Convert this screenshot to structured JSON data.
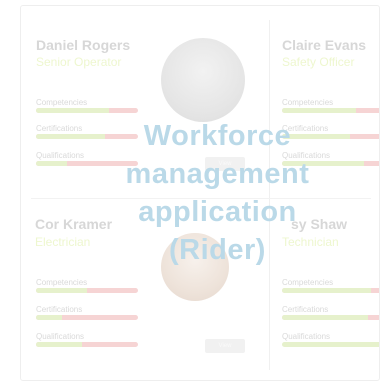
{
  "metric_labels": {
    "competencies": "Competencies",
    "certifications": "Certifications",
    "qualifications": "Qualifications"
  },
  "view_button": "View",
  "overlay": {
    "line1": "Workforce",
    "line2": "management",
    "line3": "application",
    "line4": "(Rider)"
  },
  "workers": [
    {
      "name": "Daniel Rogers",
      "role": "Senior Operator",
      "competencies": 0.72,
      "certifications": 0.68,
      "qualifications": 0.3
    },
    {
      "name": "Claire Evans",
      "role": "Safety Officer",
      "competencies": 0.7,
      "certifications": 0.65,
      "qualifications": 0.78
    },
    {
      "name": "Cor Kramer",
      "role": "Electrician",
      "competencies": 0.5,
      "certifications": 0.25,
      "qualifications": 0.45
    },
    {
      "name": "sy Shaw",
      "role": "Technician",
      "competencies": 0.85,
      "certifications": 0.82,
      "qualifications": 1.0
    }
  ],
  "colors": {
    "bar_filled": "#e6f1cc",
    "bar_empty": "#f6d4d4",
    "overlay_text": "#bad9e8"
  }
}
